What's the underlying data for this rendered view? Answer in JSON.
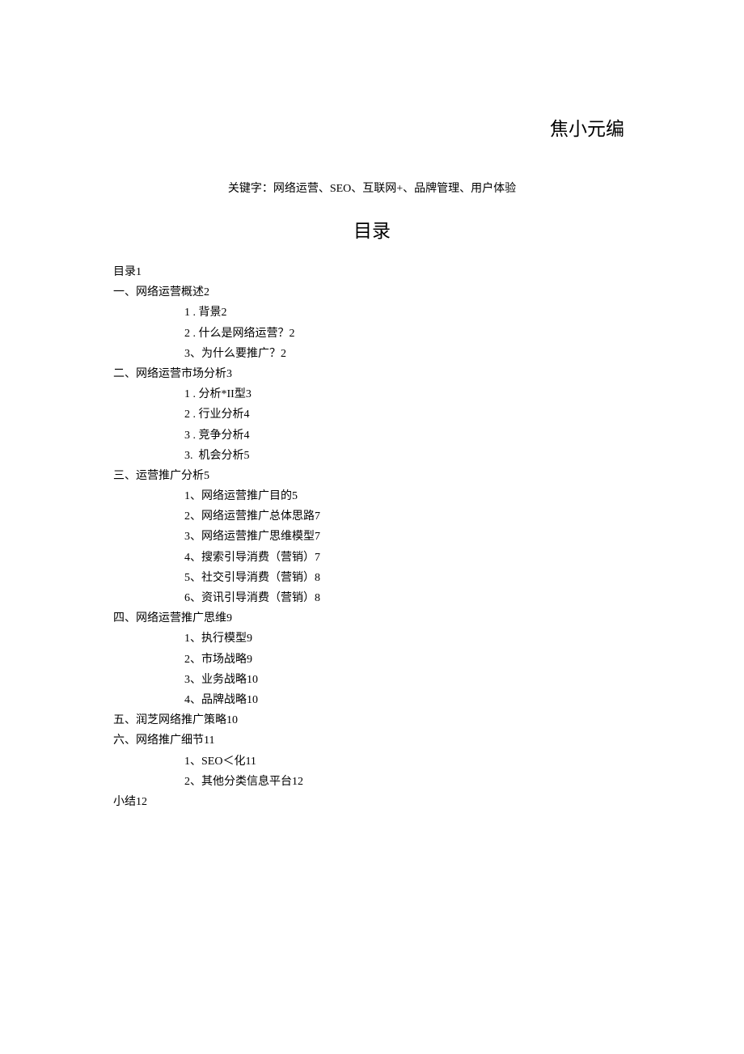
{
  "author": "焦小元编",
  "keywords": "关键字：网络运营、SEO、互联网+、品牌管理、用户体验",
  "toc_title": "目录",
  "toc": [
    {
      "text": "目录1",
      "level": 0
    },
    {
      "text": "一、网络运营概述2",
      "level": 0
    },
    {
      "text": "1 . 背景2",
      "level": 1
    },
    {
      "text": "2 . 什么是网络运营？2",
      "level": 1
    },
    {
      "text": "3、为什么要推广？2",
      "level": 1
    },
    {
      "text": "二、网络运营市场分析3",
      "level": 0
    },
    {
      "text": "1 . 分析*II型3",
      "level": 1
    },
    {
      "text": "2 . 行业分析4",
      "level": 1
    },
    {
      "text": "3 . 竞争分析4",
      "level": 1
    },
    {
      "text": "3.  机会分析5",
      "level": 1
    },
    {
      "text": "三、运营推广分析5",
      "level": 0
    },
    {
      "text": "1、网络运营推广目的5",
      "level": 1
    },
    {
      "text": "2、网络运营推广总体思路7",
      "level": 1
    },
    {
      "text": "3、网络运营推广思维模型7",
      "level": 1
    },
    {
      "text": "4、搜索引导消费（营销）7",
      "level": 1
    },
    {
      "text": "5、社交引导消费（营销）8",
      "level": 1
    },
    {
      "text": "6、资讯引导消费（营销）8",
      "level": 1
    },
    {
      "text": "四、网络运营推广思维9",
      "level": 0
    },
    {
      "text": "1、执行模型9",
      "level": 1
    },
    {
      "text": "2、市场战略9",
      "level": 1
    },
    {
      "text": "3、业务战略10",
      "level": 1
    },
    {
      "text": "4、品牌战略10",
      "level": 1
    },
    {
      "text": "五、润芝网络推广策略10",
      "level": 0
    },
    {
      "text": "六、网络推广细节11",
      "level": 0
    },
    {
      "text": "1、SEO＜化11",
      "level": 1
    },
    {
      "text": "2、其他分类信息平台12",
      "level": 1
    },
    {
      "text": "小结12",
      "level": 0
    }
  ]
}
